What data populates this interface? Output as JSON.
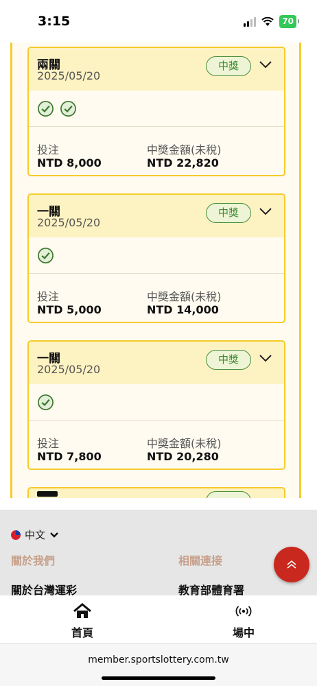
{
  "status_bar": {
    "time": "3:15",
    "battery": "70"
  },
  "tickets": [
    {
      "type": "兩關",
      "date": "2025/05/20",
      "status": "中獎",
      "checks": 2,
      "stake_label": "投注",
      "stake": "NTD 8,000",
      "prize_label": "中獎金額(未稅)",
      "prize": "NTD 22,820"
    },
    {
      "type": "一關",
      "date": "2025/05/20",
      "status": "中獎",
      "checks": 1,
      "stake_label": "投注",
      "stake": "NTD 5,000",
      "prize_label": "中獎金額(未稅)",
      "prize": "NTD 14,000"
    },
    {
      "type": "一關",
      "date": "2025/05/20",
      "status": "中獎",
      "checks": 1,
      "stake_label": "投注",
      "stake": "NTD 7,800",
      "prize_label": "中獎金額(未稅)",
      "prize": "NTD 20,280"
    }
  ],
  "footer": {
    "language": "中文",
    "about_heading": "關於我們",
    "links_heading": "相關連接",
    "about_link": "關於台灣運彩",
    "related_link": "教育部體育署"
  },
  "bottom_nav": {
    "home_label": "首頁",
    "live_label": "場中"
  },
  "browser": {
    "url": "member.sportslottery.com.tw"
  },
  "colors": {
    "accent_yellow": "#f5cc2a",
    "win_green": "#3f8a32",
    "scroll_top_red": "#c8281e"
  }
}
